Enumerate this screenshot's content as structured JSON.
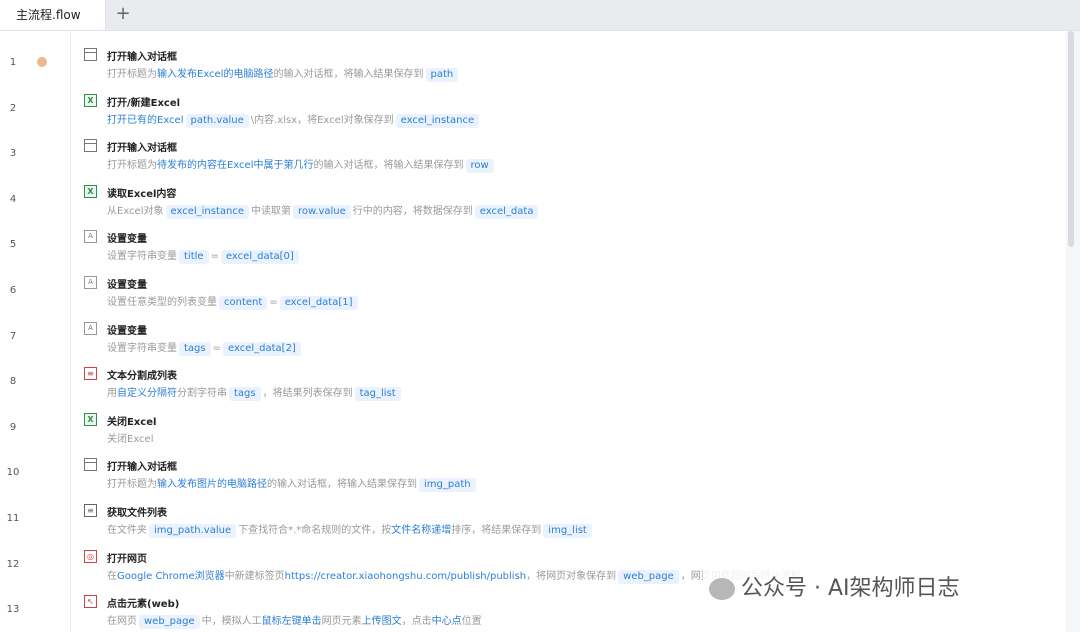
{
  "tabs": {
    "active": "主流程.flow",
    "add": "+"
  },
  "watermark": {
    "text": "公众号 · AI架构师日志",
    "logo_icon": "wechat-icon"
  },
  "rows": [
    {
      "n": "1",
      "title": "打开输入对话框",
      "icon": "dialog-icon",
      "p": [
        "打开标题为",
        "输入发布Excel的电脑路径",
        "的输入对话框，将输入结果保存到",
        "path"
      ]
    },
    {
      "n": "2",
      "title": "打开/新建Excel",
      "icon": "excel-icon",
      "p": [
        "打开已有的Excel",
        "path.value",
        "\\内容.xlsx，将Excel对象保存到",
        "excel_instance"
      ]
    },
    {
      "n": "3",
      "title": "打开输入对话框",
      "icon": "dialog-icon",
      "p": [
        "打开标题为",
        "待发布的内容在Excel中属于第几行",
        "的输入对话框，将输入结果保存到",
        "row"
      ]
    },
    {
      "n": "4",
      "title": "读取Excel内容",
      "icon": "excel-icon",
      "p": [
        "从Excel对象",
        "excel_instance",
        "中读取第",
        "row.value",
        "行中的内容，将数据保存到",
        "excel_data"
      ]
    },
    {
      "n": "5",
      "title": "设置变量",
      "icon": "variable-icon",
      "p": [
        "设置字符串变量",
        "title",
        "=",
        "excel_data[0]"
      ]
    },
    {
      "n": "6",
      "title": "设置变量",
      "icon": "variable-icon",
      "p": [
        "设置任意类型的列表变量",
        "content",
        "=",
        "excel_data[1]"
      ]
    },
    {
      "n": "7",
      "title": "设置变量",
      "icon": "variable-icon",
      "p": [
        "设置字符串变量",
        "tags",
        "=",
        "excel_data[2]"
      ]
    },
    {
      "n": "8",
      "title": "文本分割成列表",
      "icon": "split-icon",
      "p": [
        "用",
        "自定义分隔符",
        "分割字符串",
        "tags",
        "，将结果列表保存到",
        "tag_list"
      ]
    },
    {
      "n": "9",
      "title": "关闭Excel",
      "icon": "excel-close-icon",
      "p": [
        "关闭Excel"
      ]
    },
    {
      "n": "10",
      "title": "打开输入对话框",
      "icon": "dialog-icon",
      "p": [
        "打开标题为",
        "输入发布图片的电脑路径",
        "的输入对话框，将输入结果保存到",
        "img_path"
      ]
    },
    {
      "n": "11",
      "title": "获取文件列表",
      "icon": "file-list-icon",
      "p": [
        "在文件夹",
        "img_path.value",
        "下查找符合*.*命名规则的文件，按",
        "文件名称递增",
        "排序，将结果保存到",
        "img_list"
      ]
    },
    {
      "n": "12",
      "title": "打开网页",
      "icon": "web-page-icon",
      "p": [
        "在",
        "Google Chrome浏览器",
        "中新建标签页",
        "https://creator.xiaohongshu.com/publish/publish",
        "，将网页对象保存到",
        "web_page",
        "，网页加载超时后终止流程"
      ]
    },
    {
      "n": "13",
      "title": "点击元素(web)",
      "icon": "click-element-icon",
      "p": [
        "在网页",
        "web_page",
        "中，模拟人工",
        "鼠标左键单击",
        "网页元素",
        "上传图文",
        "，点击",
        "中心点",
        "位置"
      ]
    }
  ]
}
